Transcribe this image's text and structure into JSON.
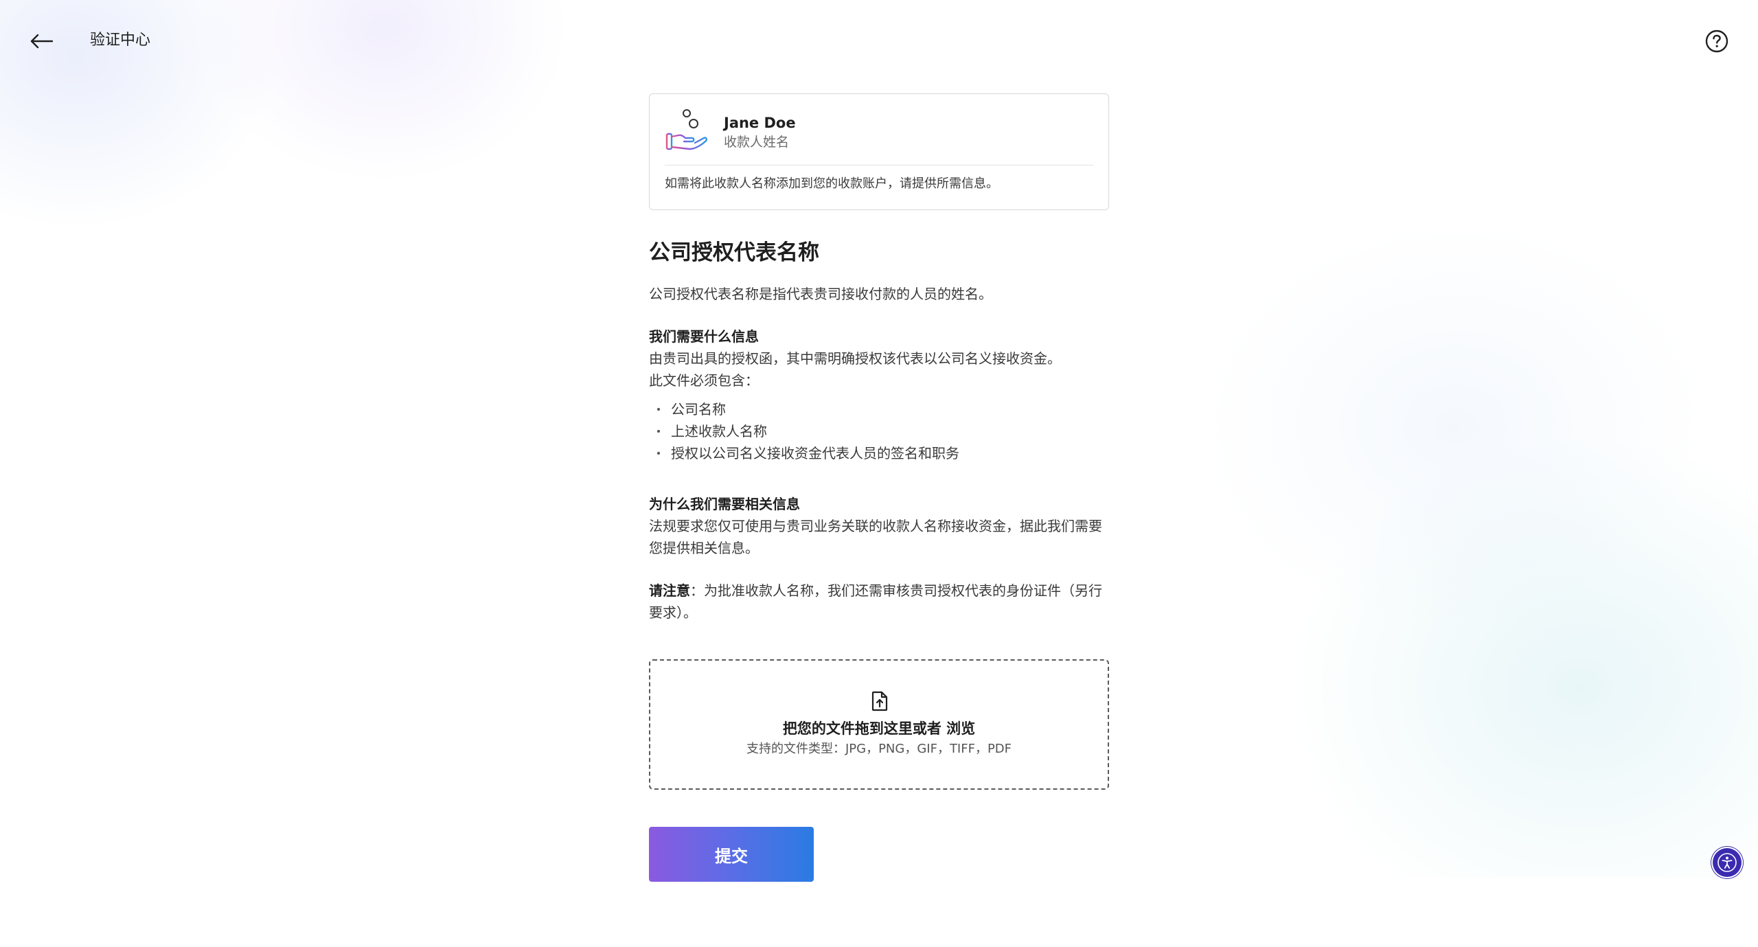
{
  "header": {
    "title": "验证中心",
    "back_icon": "arrow-left-icon",
    "help_icon": "question-circle-icon"
  },
  "payee_card": {
    "name": "Jane Doe",
    "subtitle": "收款人姓名",
    "note": "如需将此收款人名称添加到您的收款账户，请提供所需信息。",
    "illustration_icon": "hand-coins-icon"
  },
  "content": {
    "title": "公司授权代表名称",
    "intro": "公司授权代表名称是指代表贵司接收付款的人员的姓名。",
    "what_heading": "我们需要什么信息",
    "what_line1": "由贵司出具的授权函，其中需明确授权该代表以公司名义接收资金。",
    "what_line2": "此文件必须包含：",
    "requirements": [
      "公司名称",
      "上述收款人名称",
      "授权以公司名义接收资金代表人员的签名和职务"
    ],
    "why_heading": "为什么我们需要相关信息",
    "why_text": "法规要求您仅可使用与贵司业务关联的收款人名称接收资金，据此我们需要您提供相关信息。",
    "note_label": "请注意",
    "note_text": "：为批准收款人名称，我们还需审核贵司授权代表的身份证件（另行要求）。"
  },
  "upload": {
    "drop_text": "把您的文件拖到这里或者 ",
    "browse_label": "浏览",
    "file_types": "支持的文件类型：JPG，PNG，GIF，TIFF，PDF",
    "icon": "file-upload-icon"
  },
  "submit": {
    "label": "提交"
  },
  "accessibility": {
    "icon": "accessibility-icon"
  },
  "colors": {
    "button_gradient_start": "#8a5ae0",
    "button_gradient_end": "#2a7be3",
    "accessibility_button": "#3a2bb0",
    "text_primary": "#1f1f1f",
    "text_secondary": "#6b6b6b"
  }
}
